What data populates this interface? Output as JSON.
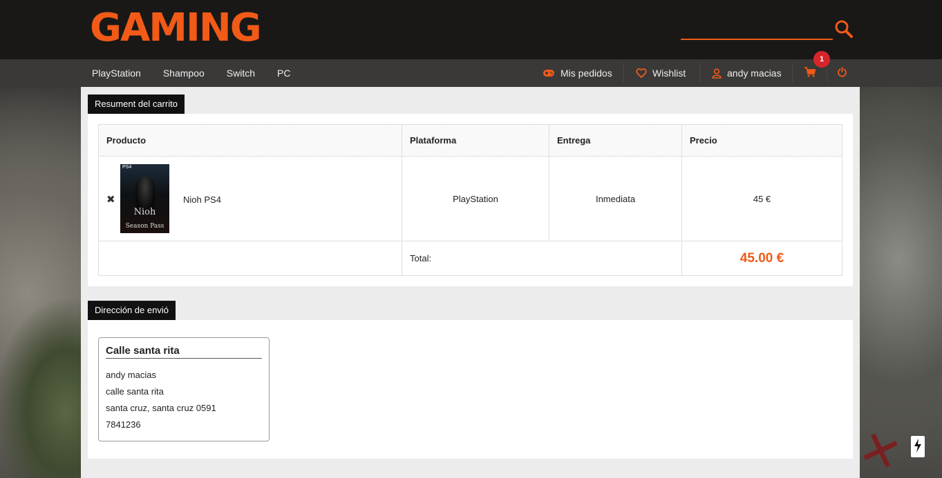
{
  "brand": {
    "logo": "GAMING",
    "accent": "#f15a17"
  },
  "search": {
    "value": "",
    "placeholder": ""
  },
  "nav": {
    "categories": [
      "PlayStation",
      "Shampoo",
      "Switch",
      "PC"
    ],
    "orders_label": "Mis pedidos",
    "wishlist_label": "Wishlist",
    "user_label": "andy macias",
    "cart_count": "1"
  },
  "cart": {
    "section_title": "Resument del carrito",
    "headers": [
      "Producto",
      "Plataforma",
      "Entrega",
      "Precio"
    ],
    "items": [
      {
        "name": "Nioh PS4",
        "platform": "PlayStation",
        "delivery": "Inmediata",
        "price": "45 €",
        "cover_badge": "PS4",
        "cover_title": "Nioh",
        "cover_subtitle": "Season Pass"
      }
    ],
    "total_label": "Total:",
    "total_value": "45.00 €"
  },
  "shipping": {
    "section_title": "Dirección de envió",
    "address": {
      "title": "Calle santa rita",
      "name": "andy macias",
      "street": "calle santa rita",
      "city": "santa cruz, santa cruz 0591",
      "phone": "7841236"
    }
  },
  "icons": [
    "search-icon",
    "gamepad-icon",
    "heart-icon",
    "user-icon",
    "cart-icon",
    "power-icon",
    "close-icon",
    "bolt-icon"
  ]
}
